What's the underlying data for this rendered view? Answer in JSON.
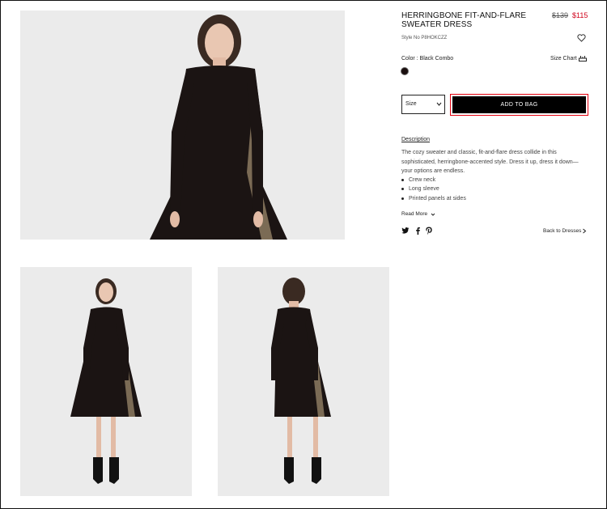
{
  "product": {
    "title": "HERRINGBONE FIT-AND-FLARE SWEATER DRESS",
    "price_original": "$139",
    "price_sale": "$115",
    "style_no": "Style No P8HOKCZZ",
    "color_label": "Color : Black Combo",
    "size_chart_label": "Size Chart",
    "size_select_label": "Size",
    "add_to_bag_label": "ADD TO BAG",
    "description_link": "Description",
    "description_text": "The cozy sweater and classic, fit-and-flare dress collide in this sophisticated, herringbone-accented style. Dress it up, dress it down—your options are endless.",
    "features": [
      "Crew neck",
      "Long sleeve",
      "Printed panels at sides"
    ],
    "read_more_label": "Read More",
    "back_link": "Back to Dresses"
  },
  "colors": {
    "accent_red": "#e3000f",
    "sale_red": "#d0021b",
    "button_bg": "#000000",
    "swatch": "#1a0e0e"
  },
  "icons": {
    "wishlist": "heart-icon",
    "size_chart": "ruler-icon",
    "select": "chevron-down-icon",
    "read_more": "chevron-down-icon",
    "back": "chevron-right-icon",
    "social": [
      "twitter-icon",
      "facebook-icon",
      "pinterest-icon"
    ]
  }
}
